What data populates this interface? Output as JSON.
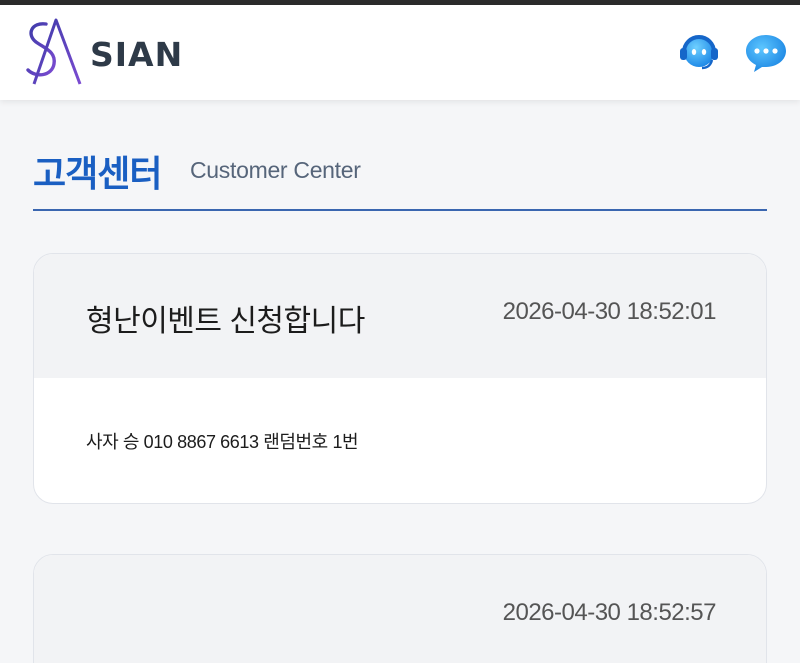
{
  "header": {
    "brand": "SIAN",
    "logo_icon": "sa-monogram-icon",
    "support_icon": "support-agent-icon",
    "chat_icon": "chat-bubble-icon",
    "accent_color": "#1a5fc2"
  },
  "section": {
    "title": "고객센터",
    "subtitle": "Customer Center"
  },
  "posts": [
    {
      "title": "형난이벤트 신청합니다",
      "date": "2026-04-30 18:52:01",
      "body": "사자 승 010 8867 6613 랜덤번호 1번"
    },
    {
      "title": "",
      "date": "2026-04-30 18:52:57",
      "body": ""
    }
  ]
}
